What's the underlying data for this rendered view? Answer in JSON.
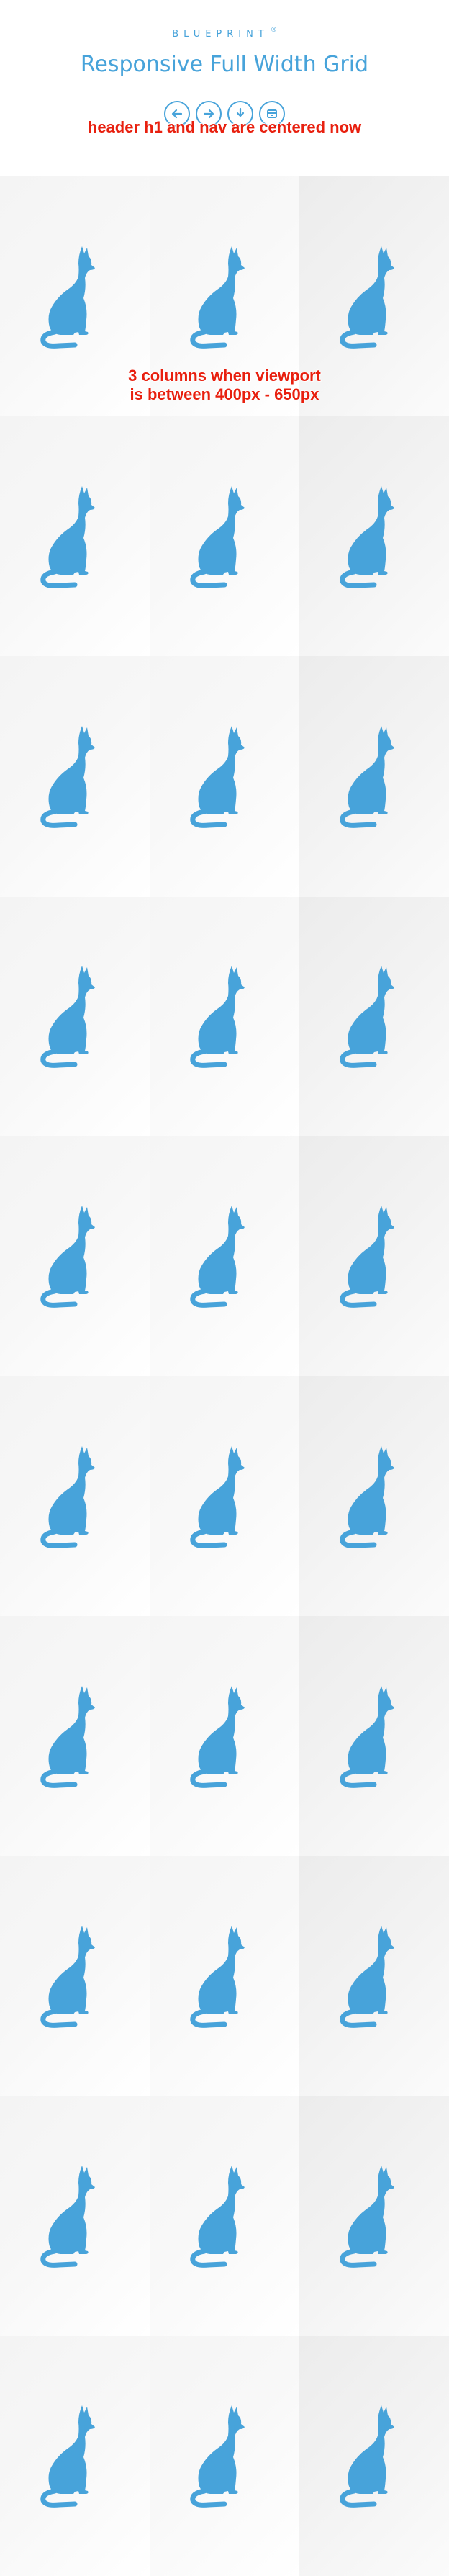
{
  "header": {
    "brand": "BLUEPRINT",
    "brand_mark": "®",
    "title": "Responsive Full Width Grid"
  },
  "nav": [
    {
      "name": "previous-demo",
      "icon": "arrow-left-icon"
    },
    {
      "name": "next-demo",
      "icon": "arrow-right-icon"
    },
    {
      "name": "download",
      "icon": "download-icon"
    },
    {
      "name": "archive",
      "icon": "archive-icon"
    }
  ],
  "annotations": {
    "header_note": "header h1  and nav are centered now",
    "grid_note_line1": "3 columns when viewport",
    "grid_note_line2": "is between 400px - 650px"
  },
  "grid": {
    "columns": 3,
    "rows": 10,
    "item_icon": "cat-icon"
  },
  "colors": {
    "accent": "#47a3da",
    "annotation": "#e8200f",
    "tile_light": "#f7f7f7"
  }
}
